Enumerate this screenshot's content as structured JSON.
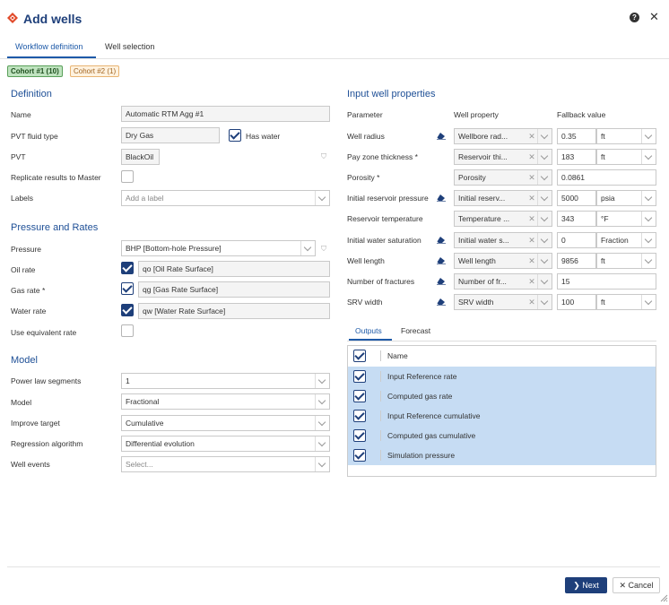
{
  "dialog": {
    "title": "Add wells",
    "help_icon": "question-circle-icon",
    "close_icon": "close-icon",
    "logo_icon": "app-logo-icon"
  },
  "tabs": [
    {
      "label": "Workflow definition",
      "active": true
    },
    {
      "label": "Well selection",
      "active": false
    }
  ],
  "cohorts": [
    {
      "label": "Cohort #1 (10)",
      "color": "#bfe3bf"
    },
    {
      "label": "Cohort #2 (1)",
      "color": "#fff2df"
    }
  ],
  "definition": {
    "title": "Definition",
    "name_label": "Name",
    "name_value": "Automatic RTM Agg #1",
    "pvt_fluid_label": "PVT fluid type",
    "pvt_fluid_value": "Dry Gas",
    "has_water_label": "Has water",
    "has_water_checked": true,
    "pvt_label": "PVT",
    "pvt_value": "BlackOil",
    "replicate_label": "Replicate results to Master",
    "replicate_checked": false,
    "labels_label": "Labels",
    "labels_placeholder": "Add a label"
  },
  "pressure_rates": {
    "title": "Pressure and Rates",
    "pressure_label": "Pressure",
    "pressure_value": "BHP [Bottom-hole Pressure]",
    "oil_rate_label": "Oil rate",
    "oil_rate_value": "qo [Oil Rate Surface]",
    "gas_rate_label": "Gas rate *",
    "gas_rate_value": "qg [Gas Rate Surface]",
    "water_rate_label": "Water rate",
    "water_rate_value": "qw [Water Rate Surface]",
    "equiv_label": "Use equivalent rate"
  },
  "model": {
    "title": "Model",
    "segments_label": "Power law segments",
    "segments_value": "1",
    "model_label": "Model",
    "model_value": "Fractional",
    "improve_label": "Improve target",
    "improve_value": "Cumulative",
    "regression_label": "Regression algorithm",
    "regression_value": "Differential evolution",
    "events_label": "Well events",
    "events_placeholder": "Select..."
  },
  "input_props": {
    "title": "Input well properties",
    "col_param": "Parameter",
    "col_prop": "Well property",
    "col_fallback": "Fallback value",
    "rows": [
      {
        "param": "Well radius",
        "prop": "Wellbore rad...",
        "value": "0.35",
        "unit": "ft"
      },
      {
        "param": "Pay zone thickness *",
        "prop": "Reservoir thi...",
        "value": "183",
        "unit": "ft"
      },
      {
        "param": "Porosity *",
        "prop": "Porosity",
        "value": "0.0861",
        "unit": ""
      },
      {
        "param": "Initial reservoir pressure",
        "prop": "Initial reserv...",
        "value": "5000",
        "unit": "psia"
      },
      {
        "param": "Reservoir temperature",
        "prop": "Temperature ...",
        "value": "343",
        "unit": "°F"
      },
      {
        "param": "Initial water saturation",
        "prop": "Initial water s...",
        "value": "0",
        "unit": "Fraction"
      },
      {
        "param": "Well length",
        "prop": "Well length",
        "value": "9856",
        "unit": "ft"
      },
      {
        "param": "Number of fractures",
        "prop": "Number of fr...",
        "value": "15",
        "unit": ""
      },
      {
        "param": "SRV width",
        "prop": "SRV width",
        "value": "100",
        "unit": "ft"
      }
    ]
  },
  "outputs": {
    "tab_outputs": "Outputs",
    "tab_forecast": "Forecast",
    "col_name": "Name",
    "rows": [
      "Input Reference rate",
      "Computed gas rate",
      "Input Reference cumulative",
      "Computed gas cumulative",
      "Simulation pressure"
    ]
  },
  "footer": {
    "next_label": "Next",
    "cancel_label": "Cancel"
  }
}
